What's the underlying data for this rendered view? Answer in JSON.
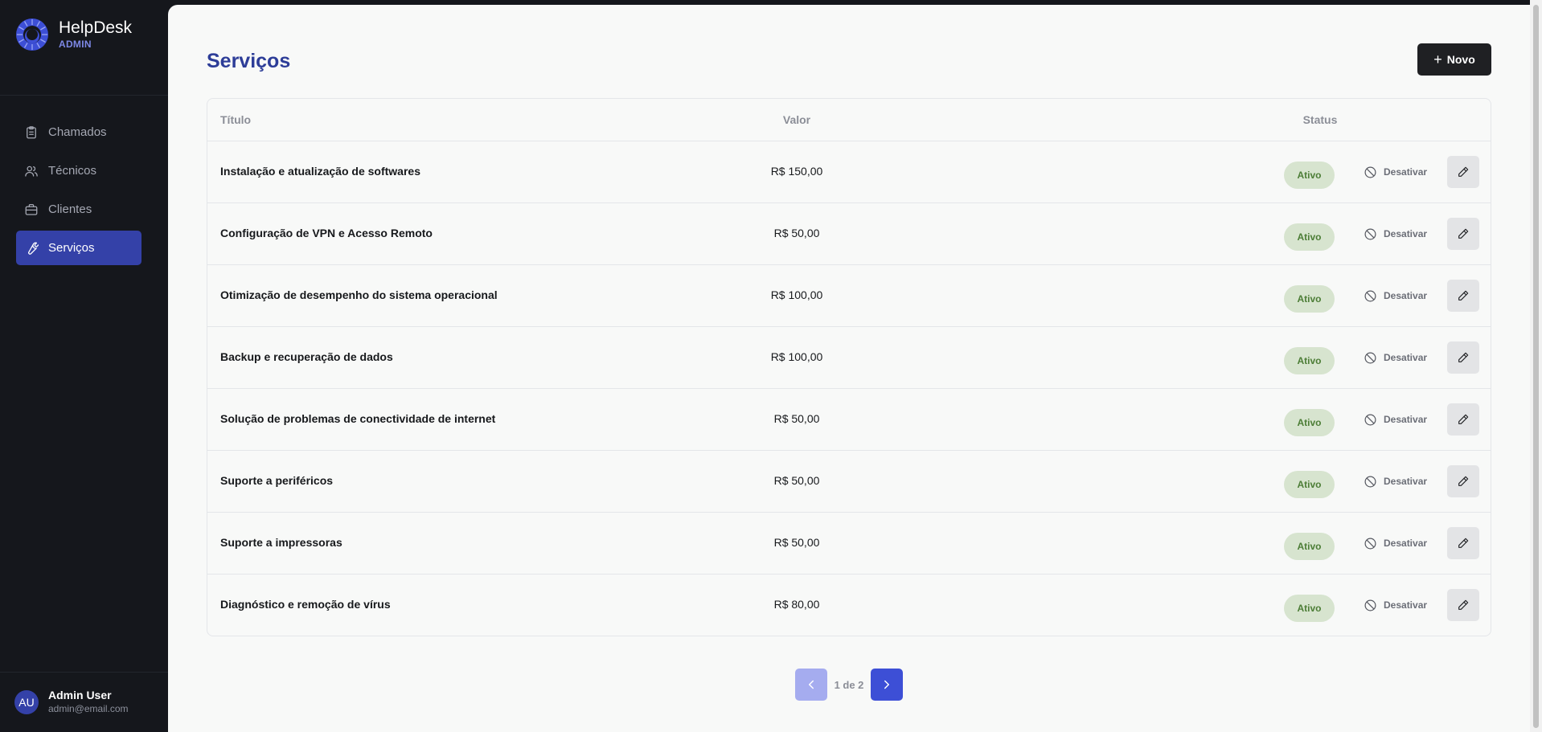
{
  "app": {
    "name": "HelpDesk",
    "role": "ADMIN"
  },
  "sidebar": {
    "items": [
      {
        "label": "Chamados",
        "icon": "clipboard-icon",
        "active": false
      },
      {
        "label": "Técnicos",
        "icon": "users-icon",
        "active": false
      },
      {
        "label": "Clientes",
        "icon": "briefcase-icon",
        "active": false
      },
      {
        "label": "Serviços",
        "icon": "wrench-icon",
        "active": true
      }
    ]
  },
  "user": {
    "initials": "AU",
    "name": "Admin User",
    "email": "admin@email.com"
  },
  "main": {
    "title": "Serviços",
    "new_button": "Novo"
  },
  "table": {
    "headers": {
      "title": "Título",
      "value": "Valor",
      "status": "Status"
    },
    "rows": [
      {
        "title": "Instalação e atualização de softwares",
        "value": "R$ 150,00",
        "status": "Ativo",
        "action": "Desativar"
      },
      {
        "title": "Configuração de VPN e Acesso Remoto",
        "value": "R$ 50,00",
        "status": "Ativo",
        "action": "Desativar"
      },
      {
        "title": "Otimização de desempenho do sistema operacional",
        "value": "R$ 100,00",
        "status": "Ativo",
        "action": "Desativar"
      },
      {
        "title": "Backup e recuperação de dados",
        "value": "R$ 100,00",
        "status": "Ativo",
        "action": "Desativar"
      },
      {
        "title": "Solução de problemas de conectividade de internet",
        "value": "R$ 50,00",
        "status": "Ativo",
        "action": "Desativar"
      },
      {
        "title": "Suporte a periféricos",
        "value": "R$ 50,00",
        "status": "Ativo",
        "action": "Desativar"
      },
      {
        "title": "Suporte a impressoras",
        "value": "R$ 50,00",
        "status": "Ativo",
        "action": "Desativar"
      },
      {
        "title": "Diagnóstico e remoção de vírus",
        "value": "R$ 80,00",
        "status": "Ativo",
        "action": "Desativar"
      }
    ]
  },
  "pagination": {
    "label": "1 de 2"
  },
  "colors": {
    "brand": "#3441a8",
    "title": "#2d3d98",
    "status_active_bg": "#d7e4cf",
    "status_active_text": "#4c7d36",
    "sidebar_bg": "#15171c"
  }
}
